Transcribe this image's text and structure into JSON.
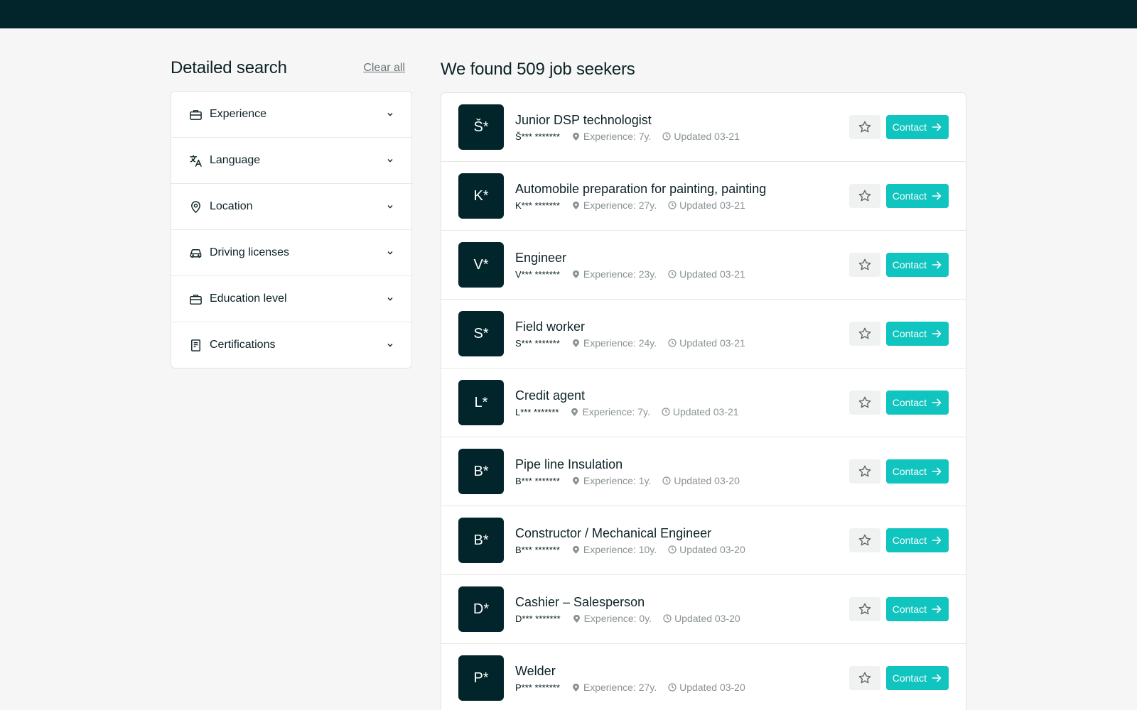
{
  "sidebar": {
    "title": "Detailed search",
    "clear_label": "Clear all",
    "filters": [
      {
        "label": "Experience",
        "icon": "briefcase-icon"
      },
      {
        "label": "Language",
        "icon": "translate-icon"
      },
      {
        "label": "Location",
        "icon": "location-pin-icon"
      },
      {
        "label": "Driving licenses",
        "icon": "car-icon"
      },
      {
        "label": "Education level",
        "icon": "briefcase-icon"
      },
      {
        "label": "Certifications",
        "icon": "document-icon"
      }
    ]
  },
  "results": {
    "title": "We found 509 job seekers",
    "contact_label": "Contact",
    "items": [
      {
        "initial": "Š*",
        "title": "Junior DSP technologist",
        "name": "Š*** *******",
        "experience": "Experience: 7y.",
        "updated": "Updated 03-21"
      },
      {
        "initial": "K*",
        "title": "Automobile preparation for painting, painting",
        "name": "K*** *******",
        "experience": "Experience: 27y.",
        "updated": "Updated 03-21"
      },
      {
        "initial": "V*",
        "title": "Engineer",
        "name": "V*** *******",
        "experience": "Experience: 23y.",
        "updated": "Updated 03-21"
      },
      {
        "initial": "S*",
        "title": "Field worker",
        "name": "S*** *******",
        "experience": "Experience: 24y.",
        "updated": "Updated 03-21"
      },
      {
        "initial": "L*",
        "title": "Credit agent",
        "name": "L*** *******",
        "experience": "Experience: 7y.",
        "updated": "Updated 03-21"
      },
      {
        "initial": "B*",
        "title": "Pipe line Insulation",
        "name": "B*** *******",
        "experience": "Experience: 1y.",
        "updated": "Updated 03-20"
      },
      {
        "initial": "B*",
        "title": "Constructor / Mechanical Engineer",
        "name": "B*** *******",
        "experience": "Experience: 10y.",
        "updated": "Updated 03-20"
      },
      {
        "initial": "D*",
        "title": "Cashier – Salesperson",
        "name": "D*** *******",
        "experience": "Experience: 0y.",
        "updated": "Updated 03-20"
      },
      {
        "initial": "P*",
        "title": "Welder",
        "name": "P*** *******",
        "experience": "Experience: 27y.",
        "updated": "Updated 03-20"
      }
    ]
  },
  "colors": {
    "header": "#01252b",
    "accent": "#10c4bf",
    "avatar": "#01252b"
  }
}
